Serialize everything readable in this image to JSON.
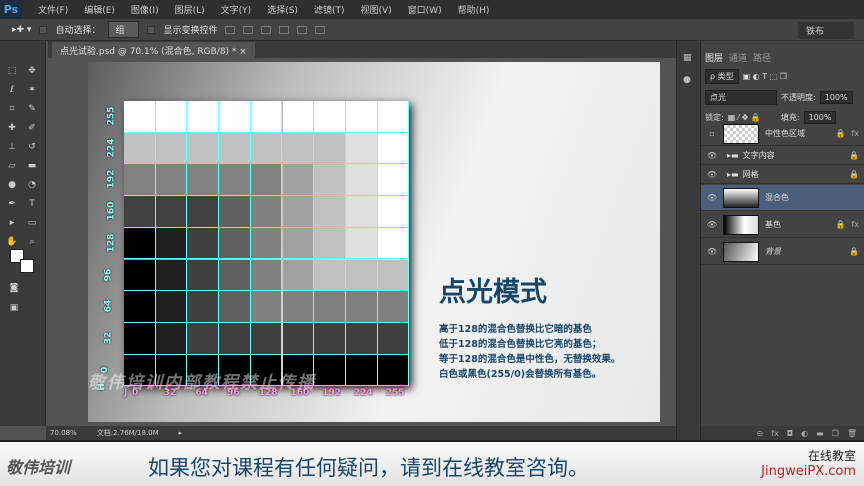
{
  "app": {
    "logo": "Ps",
    "menu": [
      "文件(F)",
      "编辑(E)",
      "图像(I)",
      "图层(L)",
      "文字(Y)",
      "选择(S)",
      "滤镜(T)",
      "视图(V)",
      "窗口(W)",
      "帮助(H)"
    ]
  },
  "options": {
    "auto_select": "自动选择：",
    "auto_select_value": "组",
    "show_transform": "显示变换控件",
    "workspace": "铁布"
  },
  "document_tab": "点光试验.psd @ 70.1% (混合色, RGB/8) * ×",
  "canvas": {
    "y_axis_prefix": "H",
    "x_axis_prefix": "J",
    "y_labels": [
      "255",
      "224",
      "192",
      "160",
      "128",
      "96",
      "64",
      "32",
      "0"
    ],
    "x_labels": [
      "0",
      "32",
      "64",
      "96",
      "128",
      "160",
      "192",
      "224",
      "255"
    ],
    "watermark": "敬伟培训内部教程禁止传播",
    "title": "点光模式",
    "lines": [
      "高于128的混合色替换比它暗的基色",
      "低于128的混合色替换比它亮的基色；",
      "等于128的混合色是中性色，无替换效果。",
      "白色或黑色(255/0)会替换所有基色。"
    ],
    "grid_color": "#66ffff"
  },
  "status": {
    "zoom": "70.08%",
    "doc": "文档:2.76M/18.0M"
  },
  "layers_panel": {
    "tabs": [
      "图层",
      "通道",
      "路径"
    ],
    "filter": "ρ 类型",
    "blend_mode": "点光",
    "opacity_label": "不透明度:",
    "opacity": "100%",
    "lock_label": "锁定:",
    "fill_label": "填充:",
    "fill": "100%",
    "layers": [
      {
        "name": "中性色区域",
        "visible": false,
        "fx": "fx",
        "selected": false
      },
      {
        "name": "文字内容",
        "visible": true,
        "folder": true,
        "selected": false
      },
      {
        "name": "网格",
        "visible": true,
        "folder": true,
        "selected": false
      },
      {
        "name": "混合色",
        "visible": true,
        "selected": true
      },
      {
        "name": "基色",
        "visible": true,
        "fx": "fx",
        "selected": false
      },
      {
        "name": "背景",
        "visible": true,
        "selected": false
      }
    ],
    "footer": [
      "⊝",
      "fx",
      "◘",
      "◐",
      "▬",
      "❐",
      "🗑"
    ]
  },
  "banner": {
    "logo": "敬伟培训",
    "text": "如果您对课程有任何疑问，请到在线教室咨询。",
    "site1": "在线教室",
    "site2": "JingweiPX.com"
  }
}
